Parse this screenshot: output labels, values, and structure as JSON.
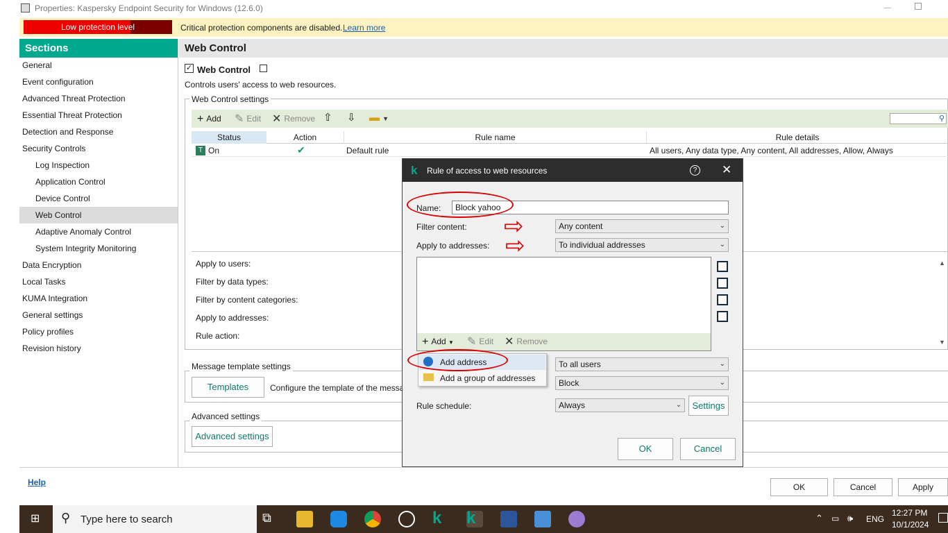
{
  "window": {
    "title": "Properties: Kaspersky Endpoint Security for Windows (12.6.0)"
  },
  "banner": {
    "level": "Low protection level",
    "message": "Critical protection components are disabled.",
    "link": "Learn more"
  },
  "sidebar": {
    "header": "Sections",
    "items": [
      {
        "label": "General"
      },
      {
        "label": "Event configuration"
      },
      {
        "label": "Advanced Threat Protection"
      },
      {
        "label": "Essential Threat Protection"
      },
      {
        "label": "Detection and Response"
      },
      {
        "label": "Security Controls"
      },
      {
        "label": "Log Inspection"
      },
      {
        "label": "Application Control"
      },
      {
        "label": "Device Control"
      },
      {
        "label": "Web Control"
      },
      {
        "label": "Adaptive Anomaly Control"
      },
      {
        "label": "System Integrity Monitoring"
      },
      {
        "label": "Data Encryption"
      },
      {
        "label": "Local Tasks"
      },
      {
        "label": "KUMA Integration"
      },
      {
        "label": "General settings"
      },
      {
        "label": "Policy profiles"
      },
      {
        "label": "Revision history"
      }
    ],
    "selected": "Web Control"
  },
  "main": {
    "header": "Web Control",
    "component_label": "Web Control",
    "component_checked": true,
    "description": "Controls users' access to web resources.",
    "settings_group": "Web Control settings",
    "toolbar": {
      "add": "Add",
      "edit": "Edit",
      "remove": "Remove"
    },
    "columns": [
      "Status",
      "Action",
      "Rule name",
      "Rule details"
    ],
    "rows": [
      {
        "status": "On",
        "rule_name": "Default rule",
        "rule_details": "All users, Any data type, Any content, All addresses, Allow, Always"
      }
    ],
    "detail_labels": [
      "Apply to users:",
      "Filter by data types:",
      "Filter by content categories:",
      "Apply to addresses:",
      "Rule action:"
    ],
    "message_group": "Message template settings",
    "templates_btn": "Templates",
    "templates_desc": "Configure the template of the messag",
    "advanced_group": "Advanced settings",
    "advanced_btn": "Advanced settings"
  },
  "dialog": {
    "title": "Rule of access to web resources",
    "name_label": "Name:",
    "name_value": "Block yahoo",
    "filter_label": "Filter content:",
    "filter_value": "Any content",
    "addr_label": "Apply to addresses:",
    "addr_value": "To individual addresses",
    "toolbar": {
      "add": "Add",
      "edit": "Edit",
      "remove": "Remove"
    },
    "menu": [
      "Add address",
      "Add a group of addresses"
    ],
    "users_value": "To all users",
    "action_value": "Block",
    "schedule_label": "Rule schedule:",
    "schedule_value": "Always",
    "settings_btn": "Settings",
    "ok": "OK",
    "cancel": "Cancel"
  },
  "footer": {
    "help": "Help",
    "ok": "OK",
    "cancel": "Cancel",
    "apply": "Apply"
  },
  "taskbar": {
    "search_placeholder": "Type here to search",
    "lang": "ENG",
    "time": "12:27 PM",
    "date": "10/1/2024"
  }
}
